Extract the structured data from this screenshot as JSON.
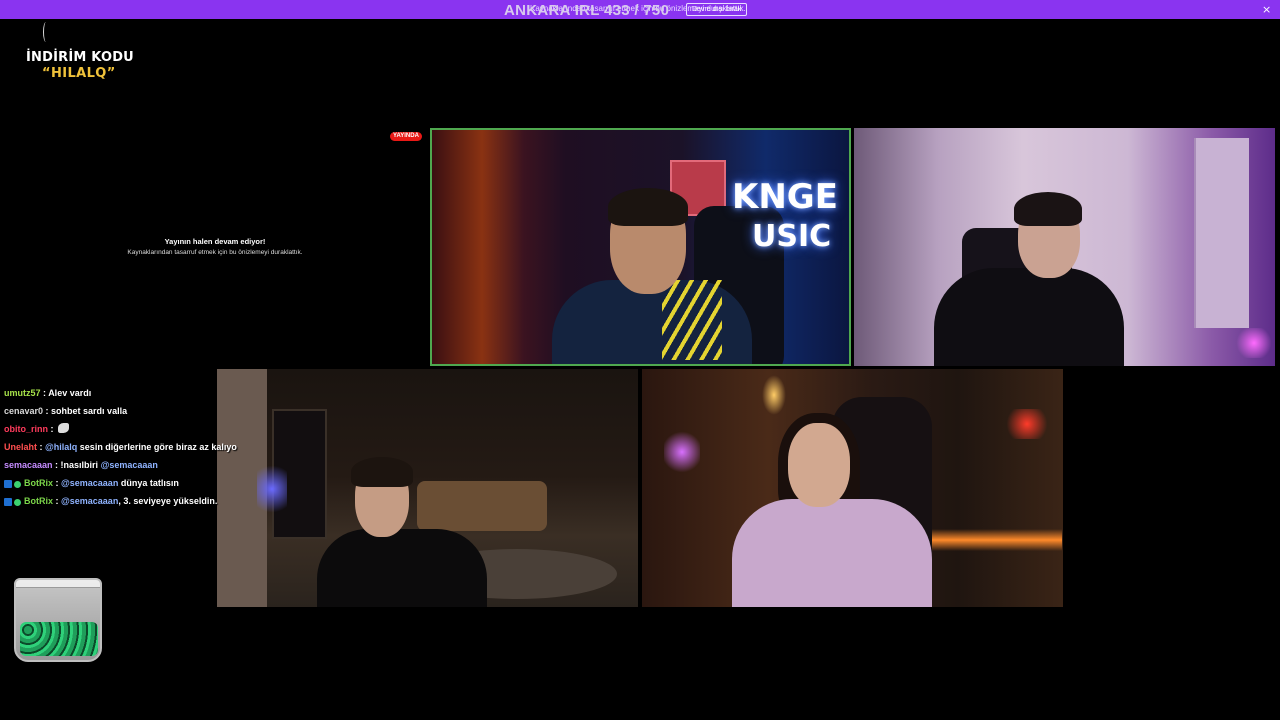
{
  "topbar": {
    "notice": "Kaynaklarından tasarruf etmek için bu önizlemeyi duraklattık.",
    "title": "ANKARA IRL 433 / 750",
    "dismiss_label": "Devre dışı bırak",
    "close_label": "×"
  },
  "promo": {
    "line1": "İNDİRİM KODU",
    "line2": "“HILALQ”"
  },
  "stream": {
    "live_badge": "YAYINDA",
    "paused_title": "Yayının halen devam ediyor!",
    "paused_subtitle": "Kaynaklarından tasarruf etmek için bu önizlemeyi duraklattık."
  },
  "cams": {
    "cam1_sign_line1": "KNGE",
    "cam1_sign_line2": "USIC"
  },
  "chat": {
    "messages": [
      {
        "user": "umutz57",
        "color": "#a7e34a",
        "sep": " : ",
        "text": "Alev vardı"
      },
      {
        "user": "cenavar0",
        "color": "#d9d9d9",
        "sep": " : ",
        "text": "sohbet sardı valla"
      },
      {
        "user": "obito_rinn",
        "color": "#ff3b5c",
        "sep": " : ",
        "text": ""
      },
      {
        "user": "Unelaht",
        "color": "#ff4f4f",
        "sep": " : ",
        "mention": "@hilalq",
        "text": " sesin diğerlerine göre biraz az kalıyo"
      },
      {
        "user": "semacaaan",
        "color": "#c58cff",
        "sep": " : ",
        "text": "!nasılbiri ",
        "mention": "@semacaaan"
      },
      {
        "user": "BotRix",
        "color": "#7cd64a",
        "sep": " : ",
        "mention": "@semacaaan",
        "text": " dünya tatlısın"
      },
      {
        "user": "BotRix",
        "color": "#7cd64a",
        "sep": " : ",
        "mention": "@semacaaan",
        "text": ", 3. seviyeye yükseldin."
      }
    ]
  },
  "icons": {
    "close": "close-icon",
    "emote": "emote-icon",
    "bot_badge": "bot-badge-icon",
    "online_badge": "online-badge-icon",
    "jar": "jar-icon"
  },
  "colors": {
    "banner": "#8a34f0",
    "live_badge": "#e91916",
    "active_cam_border": "#4fa84f",
    "promo_code": "#f0c23a",
    "mention": "#8fb3ff"
  }
}
